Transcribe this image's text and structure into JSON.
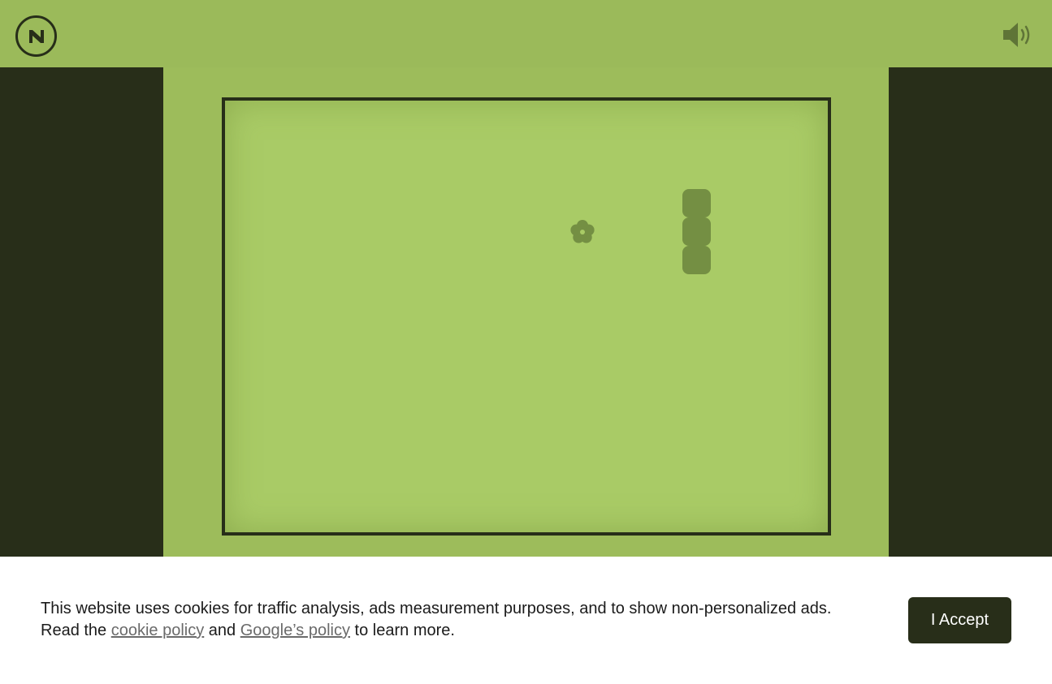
{
  "header": {
    "logo_icon": "nimble-logo-icon",
    "sound_icon": "speaker-on-icon"
  },
  "game": {
    "food_icon": "flower-icon",
    "snake_segments": 3,
    "colors": {
      "background": "#9bba5a",
      "board": "#a9cb66",
      "border": "#272e19",
      "snake": "#748f43",
      "panels": "#282e19"
    }
  },
  "cookie_banner": {
    "line1": "This website uses cookies for traffic analysis, ads measurement purposes, and to show non-personalized ads.",
    "line2_prefix": "Read the ",
    "cookie_policy_link": "cookie policy",
    "and_text": " and ",
    "google_policy_link": "Google’s policy",
    "line2_suffix": " to learn more.",
    "accept_label": "I Accept"
  }
}
